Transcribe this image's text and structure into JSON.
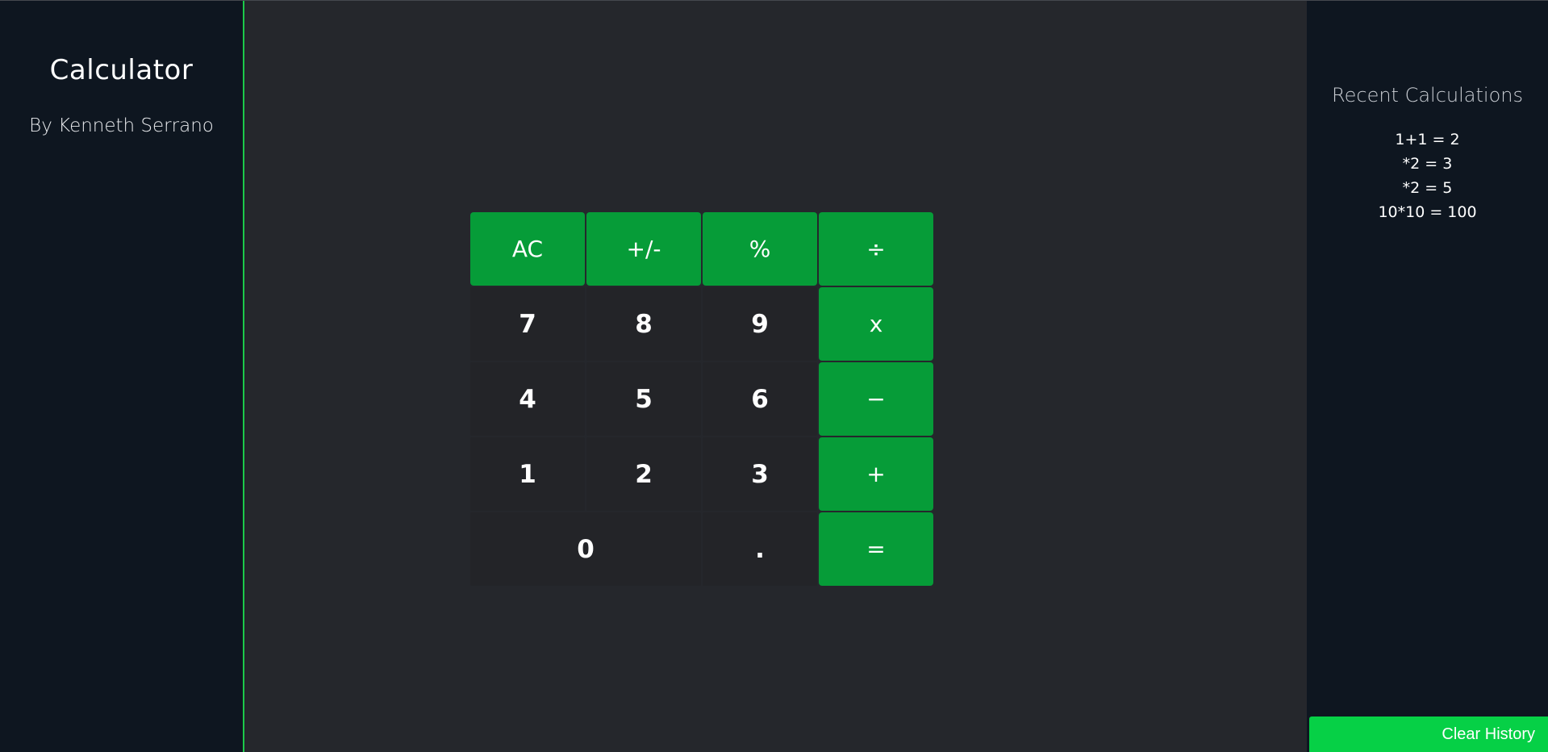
{
  "sidebar": {
    "title": "Calculator",
    "author": "By Kenneth Serrano"
  },
  "keypad": {
    "ac": "AC",
    "sign": "+/-",
    "percent": "%",
    "divide": "÷",
    "seven": "7",
    "eight": "8",
    "nine": "9",
    "multiply": "x",
    "four": "4",
    "five": "5",
    "six": "6",
    "subtract": "−",
    "one": "1",
    "two": "2",
    "three": "3",
    "add": "+",
    "zero": "0",
    "decimal": ".",
    "equals": "="
  },
  "history": {
    "title": "Recent Calculations",
    "items": [
      "1+1 = 2",
      "*2 = 3",
      "*2 = 5",
      "10*10 = 100"
    ],
    "clear_label": "Clear History"
  },
  "colors": {
    "accent": "#069c38",
    "clear_button": "#06d046",
    "sidebar_bg": "#0e1620",
    "main_bg": "#25272c",
    "divider": "#1cc94a"
  }
}
